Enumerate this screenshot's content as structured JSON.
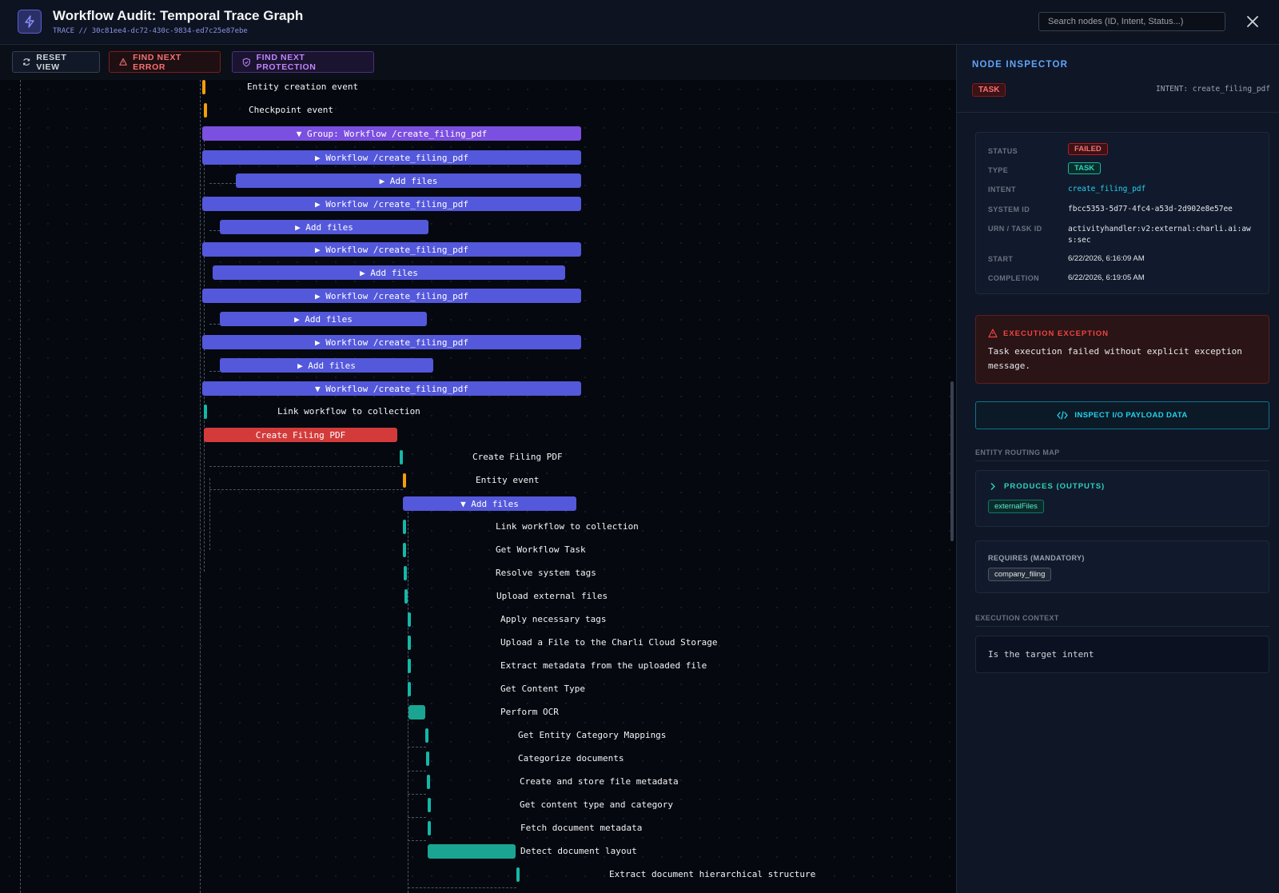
{
  "header": {
    "title": "Workflow Audit: Temporal Trace Graph",
    "trace_label": "TRACE // 30c81ee4-dc72-430c-9834-ed7c25e87ebe",
    "search_placeholder": "Search nodes (ID, Intent, Status...)"
  },
  "toolbar": {
    "reset_label": "RESET VIEW",
    "error_label": "FIND NEXT ERROR",
    "protection_label": "FIND NEXT PROTECTION"
  },
  "graph": {
    "nodes": [
      "Entity creation event",
      "Checkpoint event",
      "▼ Group: Workflow /create_filing_pdf",
      "▶ Workflow /create_filing_pdf",
      "▶ Add files",
      "▶ Workflow /create_filing_pdf",
      "▶ Add files",
      "▶ Workflow /create_filing_pdf",
      "▶ Add files",
      "▶ Workflow /create_filing_pdf",
      "▶ Add files",
      "▶ Workflow /create_filing_pdf",
      "▶ Add files",
      "▼ Workflow /create_filing_pdf",
      "Link workflow to collection",
      "Create Filing PDF",
      "Create Filing PDF",
      "Entity event",
      "▼ Add files",
      "Link workflow to collection",
      "Get Workflow Task",
      "Resolve system tags",
      "Upload external files",
      "Apply necessary tags",
      "Upload a File to the Charli Cloud Storage",
      "Extract metadata from the uploaded file",
      "Get Content Type",
      "Perform OCR",
      "Get Entity Category Mappings",
      "Categorize documents",
      "Create and store file metadata",
      "Get content type and category",
      "Fetch document metadata",
      "Detect document layout",
      "Extract document hierarchical structure"
    ]
  },
  "inspector": {
    "title": "NODE INSPECTOR",
    "kind_badge": "TASK",
    "intent_header": "INTENT: create_filing_pdf",
    "details": {
      "status_key": "STATUS",
      "status_val": "FAILED",
      "type_key": "TYPE",
      "type_val": "TASK",
      "intent_key": "INTENT",
      "intent_val": "create_filing_pdf",
      "system_key": "SYSTEM ID",
      "system_val": "fbcc5353-5d77-4fc4-a53d-2d902e8e57ee",
      "urn_key": "URN / TASK ID",
      "urn_val": "activityhandler:v2:external:charli.ai:aws:sec",
      "start_key": "START",
      "start_val": "6/22/2026, 6:16:09 AM",
      "completion_key": "COMPLETION",
      "completion_val": "6/22/2026, 6:19:05 AM"
    },
    "exception": {
      "title": "EXECUTION EXCEPTION",
      "message": "Task execution failed without explicit exception message."
    },
    "inspect_button": "INSPECT I/O PAYLOAD DATA",
    "routing": {
      "heading": "ENTITY ROUTING MAP",
      "produces_label": "PRODUCES (OUTPUTS)",
      "produces_item": "externalFiles",
      "requires_label": "REQUIRES (MANDATORY)",
      "requires_item": "company_filing"
    },
    "context": {
      "heading": "EXECUTION CONTEXT",
      "text": "Is the target intent"
    }
  },
  "colors": {
    "workflow": "#5458db",
    "group": "#7b4fe0",
    "error": "#d33b3b",
    "task": "#14b8a6",
    "event": "#f59e0b"
  }
}
